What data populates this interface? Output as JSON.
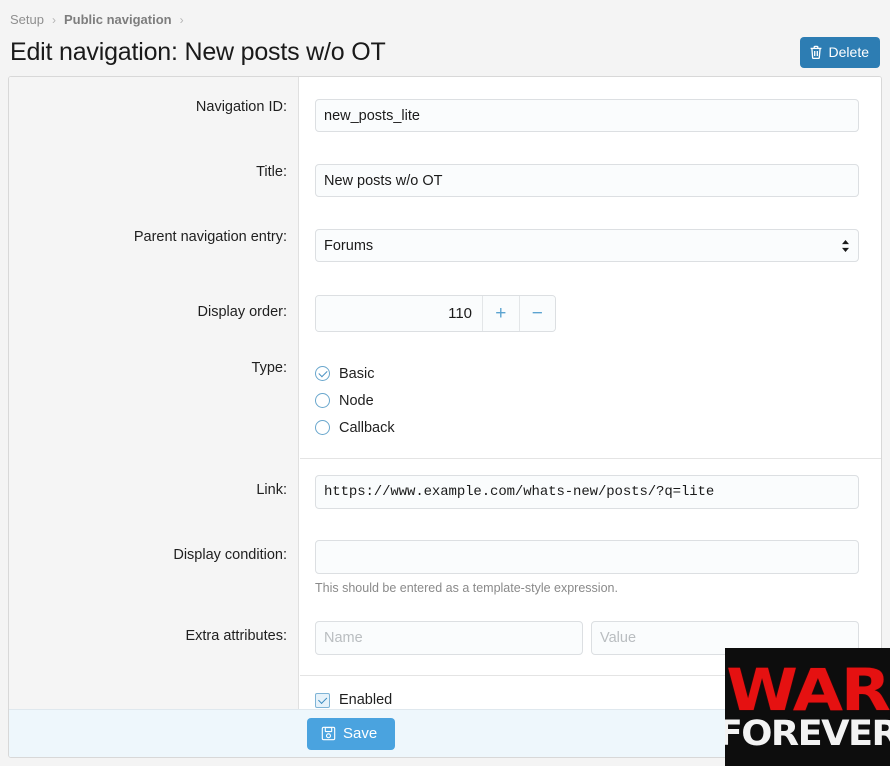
{
  "breadcrumb": {
    "items": [
      "Setup",
      "Public navigation"
    ],
    "separator": "›"
  },
  "header": {
    "title": "Edit navigation: New posts w/o OT",
    "delete_label": "Delete",
    "delete_icon": "trash-icon",
    "delete_color": "#2d7db3"
  },
  "form": {
    "navigation_id": {
      "label": "Navigation ID:",
      "value": "new_posts_lite"
    },
    "title": {
      "label": "Title:",
      "value": "New posts w/o OT"
    },
    "parent": {
      "label": "Parent navigation entry:",
      "value": "Forums",
      "options": [
        "Forums"
      ]
    },
    "display_order": {
      "label": "Display order:",
      "value": "110",
      "increment_label": "+",
      "decrement_label": "−"
    },
    "type": {
      "label": "Type:",
      "options": [
        {
          "label": "Basic",
          "checked": true
        },
        {
          "label": "Node",
          "checked": false
        },
        {
          "label": "Callback",
          "checked": false
        }
      ]
    },
    "link": {
      "label": "Link:",
      "value": "https://www.example.com/whats-new/posts/?q=lite"
    },
    "display_condition": {
      "label": "Display condition:",
      "value": "",
      "hint": "This should be entered as a template-style expression."
    },
    "extra_attributes": {
      "label": "Extra attributes:",
      "name_placeholder": "Name",
      "name_value": "",
      "value_placeholder": "Value",
      "value_value": ""
    },
    "enabled": {
      "label": "Enabled",
      "checked": true
    }
  },
  "footer": {
    "save_label": "Save",
    "save_icon": "floppy-disk-icon",
    "save_color": "#4aa3df"
  },
  "watermark": {
    "line1": "WAR",
    "line2": "FOREVER",
    "line1_color": "#e51111",
    "line2_color": "#f3f3f3",
    "background": "#0d0d0d"
  }
}
